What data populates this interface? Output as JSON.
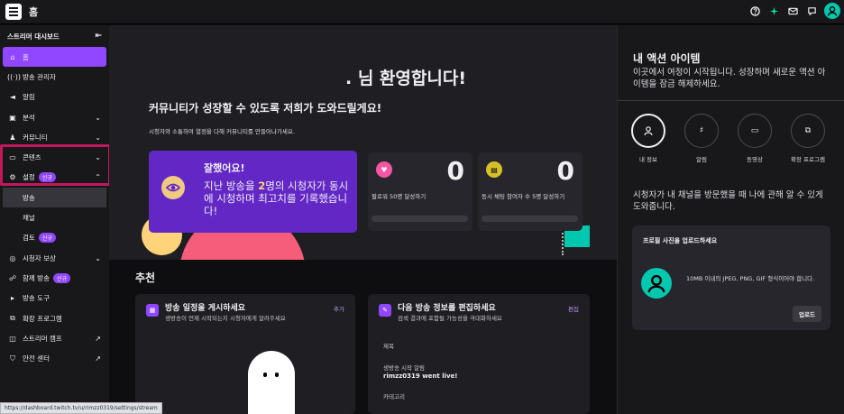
{
  "topbar": {
    "title": "홈",
    "icons": [
      "help-icon",
      "sparkle-icon",
      "mail-icon",
      "chat-icon",
      "avatar"
    ]
  },
  "sidebar": {
    "header": "스트리머 대시보드",
    "items": [
      {
        "label": "홈",
        "icon": "home-icon"
      },
      {
        "label": "방송 관리자",
        "icon": "broadcast-icon"
      },
      {
        "label": "알림",
        "icon": "megaphone-icon"
      },
      {
        "label": "분석",
        "icon": "analytics-icon"
      },
      {
        "label": "커뮤니티",
        "icon": "community-icon"
      },
      {
        "label": "콘텐츠",
        "icon": "content-icon"
      },
      {
        "label": "설정",
        "icon": "gear-icon",
        "badge": "신규"
      },
      {
        "label": "방송"
      },
      {
        "label": "채널"
      },
      {
        "label": "검토",
        "badge": "신규"
      },
      {
        "label": "시청자 보상",
        "icon": "rewards-icon"
      },
      {
        "label": "함께 방송",
        "icon": "collab-icon",
        "badge": "신규"
      },
      {
        "label": "방송 도구",
        "icon": "camera-icon"
      },
      {
        "label": "확장 프로그램",
        "icon": "extension-icon"
      },
      {
        "label": "스트리머 캠프",
        "icon": "book-icon"
      },
      {
        "label": "안전 센터",
        "icon": "shield-icon"
      }
    ]
  },
  "hero": {
    "welcome": ". 님 환영합니다!",
    "subtitle": "커뮤니티가 성장할 수 있도록 저희가 도와드릴게요!",
    "description": "시청자와 소통하여 열정을 다해 커뮤니티를 만들어나가세요.",
    "main_card": {
      "title": "잘했어요!",
      "text_before": "지난 방송을 ",
      "text_bold": "2",
      "text_after": "명의 시청자가 동시에 시청하며 최고치를 기록했습니다!"
    },
    "stats": [
      {
        "value": "0",
        "label": "팔로워 50명 달성하기",
        "icon": "heart-icon",
        "color": "#f556a6"
      },
      {
        "value": "0",
        "label": "동시 채팅 참여자 수 5명 달성하기",
        "icon": "chat-icon",
        "color": "#d5c02a"
      }
    ]
  },
  "recommend": {
    "title": "추천",
    "panel1": {
      "title": "방송 일정을 게시하세요",
      "desc": "생방송이 언제 시작되는지 시청자에게 알려주세요",
      "action": "추가"
    },
    "panel2": {
      "title": "다음 방송 정보를 편집하세요",
      "desc": "검색 결과에 포함될 가능성을 극대화하세요",
      "action": "편집",
      "field_title_label": "제목",
      "field_notify_label": "생방송 시작 알림",
      "field_notify_value": "rimzz0319 went live!",
      "field_category_label": "카테고리"
    }
  },
  "right": {
    "title": "내 액션 아이템",
    "desc": "이곳에서 여정이 시작됩니다. 성장하며 새로운 액션 아이템을 잠금 해제하세요.",
    "actions": [
      {
        "label": "내 정보",
        "icon": "user-icon"
      },
      {
        "label": "알림",
        "icon": "bell-icon"
      },
      {
        "label": "동영상",
        "icon": "video-icon"
      },
      {
        "label": "확장 프로그램",
        "icon": "extension-icon"
      }
    ],
    "info": "시청자가 내 채널을 방문했을 때 나에 관해 알 수 있게 도와줍니다.",
    "upload_card": {
      "title": "프로필 사진을 업로드하세요",
      "desc": "10MB 이내의 JPEG, PNG, GIF 형식이어야 합니다.",
      "button": "업로드"
    }
  },
  "status_url": "https://dashboard.twitch.tv/u/rimzz0319/settings/stream",
  "colors": {
    "accent": "#9147ff",
    "teal": "#00c8af",
    "highlight": "#c2185b"
  }
}
